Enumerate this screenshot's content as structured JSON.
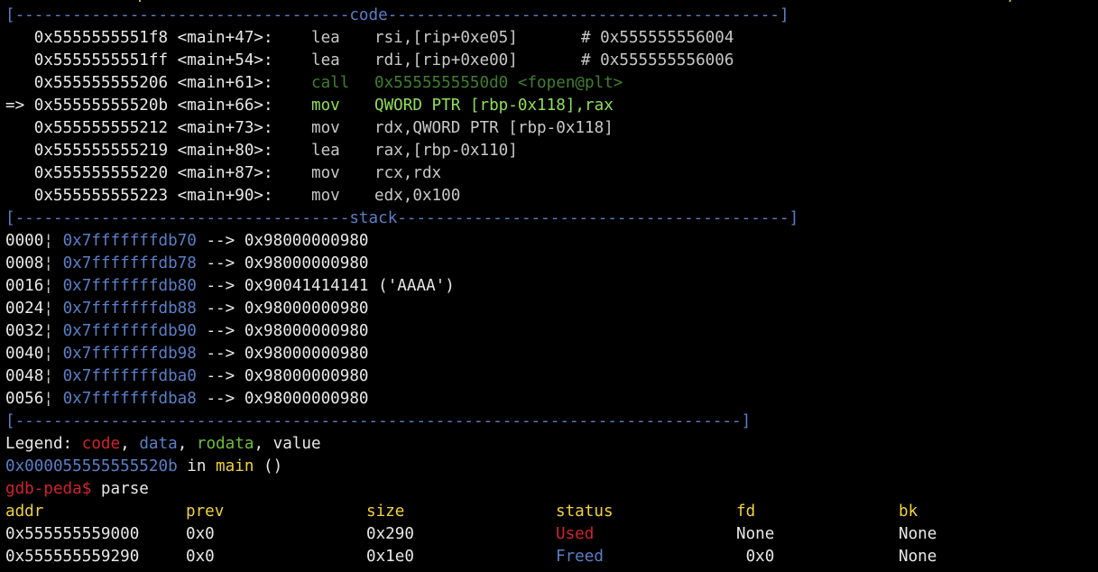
{
  "top_partial": "(                                                                                          )",
  "sep_code": {
    "left": "[-----------------------------------",
    "title": "code",
    "right": "-----------------------------------------]"
  },
  "code_lines": [
    {
      "marker": "  ",
      "addr": "0x5555555551f8",
      "sym": "<main+47>:",
      "op": "lea",
      "args": "rsi,[rip+0xe05]",
      "comment": "# 0x555555556004",
      "style": "normal"
    },
    {
      "marker": "  ",
      "addr": "0x5555555551ff",
      "sym": "<main+54>:",
      "op": "lea",
      "args": "rdi,[rip+0xe00]",
      "comment": "# 0x555555556006",
      "style": "normal"
    },
    {
      "marker": "  ",
      "addr": "0x555555555206",
      "sym": "<main+61>:",
      "op": "call",
      "args": "0x5555555550d0 <fopen@plt>",
      "comment": "",
      "style": "call"
    },
    {
      "marker": "=>",
      "addr": "0x55555555520b",
      "sym": "<main+66>:",
      "op": "mov",
      "args": "QWORD PTR [rbp-0x118],rax",
      "comment": "",
      "style": "current"
    },
    {
      "marker": "  ",
      "addr": "0x555555555212",
      "sym": "<main+73>:",
      "op": "mov",
      "args": "rdx,QWORD PTR [rbp-0x118]",
      "comment": "",
      "style": "normal"
    },
    {
      "marker": "  ",
      "addr": "0x555555555219",
      "sym": "<main+80>:",
      "op": "lea",
      "args": "rax,[rbp-0x110]",
      "comment": "",
      "style": "normal"
    },
    {
      "marker": "  ",
      "addr": "0x555555555220",
      "sym": "<main+87>:",
      "op": "mov",
      "args": "rcx,rdx",
      "comment": "",
      "style": "normal"
    },
    {
      "marker": "  ",
      "addr": "0x555555555223",
      "sym": "<main+90>:",
      "op": "mov",
      "args": "edx,0x100",
      "comment": "",
      "style": "normal"
    }
  ],
  "sep_stack": {
    "left": "[-----------------------------------",
    "title": "stack",
    "right": "-----------------------------------------]"
  },
  "stack_lines": [
    {
      "off": "0000",
      "addr": "0x7fffffffdb70",
      "arrow": "-->",
      "val": "0x98000000980"
    },
    {
      "off": "0008",
      "addr": "0x7fffffffdb78",
      "arrow": "-->",
      "val": "0x98000000980"
    },
    {
      "off": "0016",
      "addr": "0x7fffffffdb80",
      "arrow": "-->",
      "val": "0x90041414141 ('AAAA')"
    },
    {
      "off": "0024",
      "addr": "0x7fffffffdb88",
      "arrow": "-->",
      "val": "0x98000000980"
    },
    {
      "off": "0032",
      "addr": "0x7fffffffdb90",
      "arrow": "-->",
      "val": "0x98000000980"
    },
    {
      "off": "0040",
      "addr": "0x7fffffffdb98",
      "arrow": "-->",
      "val": "0x98000000980"
    },
    {
      "off": "0048",
      "addr": "0x7fffffffdba0",
      "arrow": "-->",
      "val": "0x98000000980"
    },
    {
      "off": "0056",
      "addr": "0x7fffffffdba8",
      "arrow": "-->",
      "val": "0x98000000980"
    }
  ],
  "sep_end": "[----------------------------------------------------------------------------]",
  "legend": {
    "prefix": "Legend: ",
    "code": "code",
    "c1": ", ",
    "data": "data",
    "c2": ", ",
    "rodata": "rodata",
    "c3": ", ",
    "value": "value"
  },
  "location": {
    "addr": "0x000055555555520b",
    "in": " in ",
    "func": "main",
    "rest": " ()"
  },
  "prompt": {
    "label": "gdb-peda$",
    "command": " parse"
  },
  "heap_table": {
    "headers": [
      "addr",
      "prev",
      "size",
      "status",
      "fd",
      "bk"
    ],
    "rows": [
      {
        "addr": "0x555555559000",
        "prev": "0x0",
        "size": "0x290",
        "status": "Used",
        "fd": "None",
        "bk": "None"
      },
      {
        "addr": "0x555555559290",
        "prev": "0x0",
        "size": "0x1e0",
        "status": "Freed",
        "fd": " 0x0",
        "bk": "None"
      }
    ]
  },
  "colors": {
    "background": "#000000",
    "separator": "#5a7fc8",
    "current_line": "#8fe05a",
    "call_line": "#3f7f2f",
    "prompt": "#d0232b",
    "header": "#f1d23a"
  }
}
